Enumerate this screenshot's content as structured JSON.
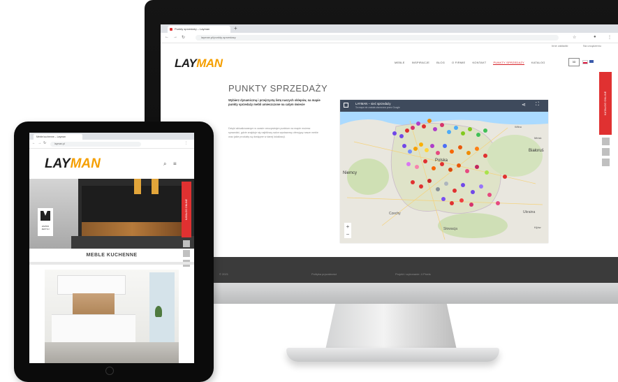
{
  "desktop": {
    "browser": {
      "tab_title": "Punkty sprzedaży – Layman",
      "url": "layman.pl/punkty-sprzedazy",
      "bookmarks": [
        "Inne zakładki",
        "Na urządzeniu"
      ]
    },
    "site": {
      "logo_main": "LAY",
      "logo_accent": "MAN",
      "menu": [
        "MEBLE",
        "INSPIRACJE",
        "BLOG",
        "O FIRMIE",
        "KONTAKT",
        "PUNKTY SPRZEDAŻY",
        "KATALOG"
      ],
      "menu_active_index": 5,
      "header_button": "3D",
      "page_title": "PUNKTY SPRZEDAŻY",
      "lead": "Wybierz dynamiczną i przejrzystą listę naszych sklepów, na mapie punkty sprzedaży mebli umieszczone na całym świecie",
      "body": "Dzięki aktualizowanym w czasie rzeczywistym punktom na mapie możesz sprawdzić, gdzie znajduje się najbliższy salon wystawowy oferujący nasze meble oraz jakie produkty są dostępne w danej lokalizacji.",
      "map": {
        "title": "LAYMAN – sieć sprzedaży",
        "subtitle": "Ta mapa nie została utworzona przez Google",
        "labels": [
          "Polska",
          "Niemcy",
          "Białoruś",
          "Ukraina",
          "Słowacja",
          "Czechy",
          "Wilno",
          "Mińsk",
          "Kijów"
        ]
      },
      "side_tab": "KATALOG ONLINE",
      "footer": [
        "© 2021",
        "Polityka prywatności",
        "Projekt i wykonanie: 4 Pixels"
      ]
    }
  },
  "tablet": {
    "browser": {
      "tab_title": "Meble kuchenne – Layman",
      "url": "layman.pl"
    },
    "site": {
      "logo_main": "LAY",
      "logo_accent": "MAN",
      "badge": "ZAPRO JEKTUJ",
      "side_tab": "KATALOG ONLINE",
      "section_title": "MEBLE KUCHENNE"
    }
  },
  "colors": {
    "accent_red": "#e03131",
    "logo_accent": "#f59f00",
    "dark": "#0b0b0b"
  }
}
